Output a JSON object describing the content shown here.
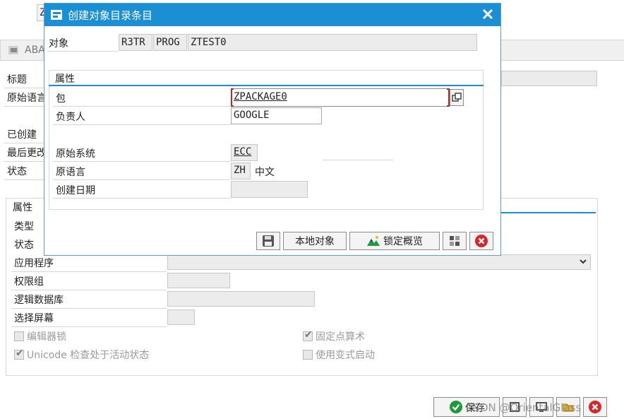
{
  "bg_window": {
    "top_field_value": "Z",
    "panel_title_abbrev": "ABA",
    "labels": {
      "title": "标题",
      "orig_lang": "原始语言",
      "created": "已创建",
      "last_changed": "最后更改",
      "status": "状态"
    },
    "attr_group": {
      "header": "属性",
      "type": "类型",
      "status": "状态",
      "application": "应用程序",
      "auth_group": "权限组",
      "logical_db": "逻辑数据库",
      "selection_screen": "选择屏幕"
    },
    "checkboxes": [
      {
        "label": "编辑器锁",
        "checked": false
      },
      {
        "label": "Unicode 检查处于活动状态",
        "checked": true
      },
      {
        "label": "固定点算术",
        "checked": true
      },
      {
        "label": "使用变式启动",
        "checked": false
      }
    ],
    "save_label": "保存",
    "watermark": "CSDN @OrientalGlass"
  },
  "dialog": {
    "title": "创建对象目录条目",
    "object_label": "对象",
    "object_type": "R3TR",
    "object_kind": "PROG",
    "object_name": "ZTEST0",
    "group_title": "属性",
    "package_label": "包",
    "package_value": "ZPACKAGE0",
    "owner_label": "负责人",
    "owner_value": "GOOGLE",
    "orig_system_label": "原始系统",
    "orig_system_value": "ECC",
    "orig_lang_label": "原语言",
    "orig_lang_code": "ZH",
    "orig_lang_text": "中文",
    "created_on_label": "创建日期",
    "created_on_value": "",
    "buttons": {
      "local_object": "本地对象",
      "lock_overview": "锁定概览"
    }
  },
  "colors": {
    "titlebar": "#1a8fd4",
    "accent_line": "#1a8fd4",
    "cancel_red": "#d9262c",
    "check_green": "#1f9a3b"
  }
}
